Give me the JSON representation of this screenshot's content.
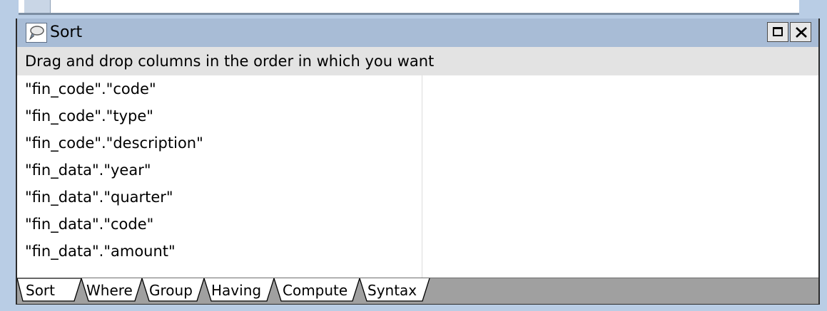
{
  "window": {
    "title": "Sort",
    "icon": "sort-icon"
  },
  "hint": "Drag and drop columns in the order in which you want",
  "columns": [
    "\"fin_code\".\"code\"",
    "\"fin_code\".\"type\"",
    "\"fin_code\".\"description\"",
    "\"fin_data\".\"year\"",
    "\"fin_data\".\"quarter\"",
    "\"fin_data\".\"code\"",
    "\"fin_data\".\"amount\""
  ],
  "tabs": [
    {
      "label": "Sort",
      "active": true
    },
    {
      "label": "Where",
      "active": false
    },
    {
      "label": "Group",
      "active": false
    },
    {
      "label": "Having",
      "active": false
    },
    {
      "label": "Compute",
      "active": false
    },
    {
      "label": "Syntax",
      "active": false
    }
  ],
  "colors": {
    "titlebar": "#a8bcd6",
    "background": "#b9cde5",
    "tab_area": "#a0a0a0"
  }
}
